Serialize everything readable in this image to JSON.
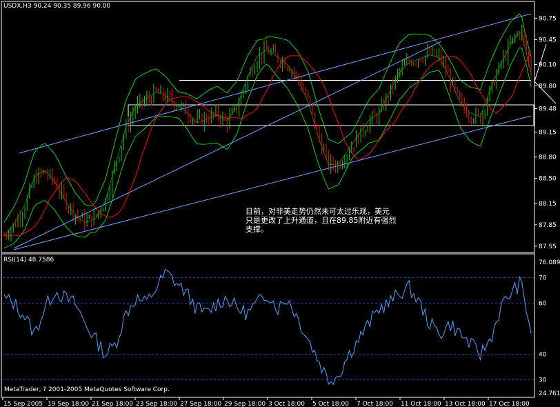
{
  "window": {
    "symbol_header": "USDX,H3  90.24 90.35 89.96 90.00",
    "copyright": "MetaTrader, ? 2001-2005 MetaQuotes Software Corp."
  },
  "annotation": {
    "line1": "目前，对非美走势仍然未可太过乐观，美元",
    "line2": "只是更改了上升通道，且在89.85附近有强烈",
    "line3": "支撑。"
  },
  "colors": {
    "background": "#000000",
    "frame": "#ffffff",
    "bull_candle": "#00cc00",
    "bear_candle": "#ff0000",
    "bollinger": "#00ff00",
    "moving_average": "#ff0000",
    "trendlines": "#6ea0ff",
    "rsi_line": "#4aa3ff",
    "rsi_levels": "#1f3fbf"
  },
  "chart_data": [
    {
      "type": "line",
      "title": "USDX,H3  90.24 90.35 89.96 90.00",
      "yticks": [
        "90.75",
        "90.45",
        "90.10",
        "89.80",
        "89.48",
        "89.15",
        "88.80",
        "88.50",
        "88.15",
        "87.85",
        "87.55"
      ],
      "ylim": [
        87.5,
        90.85
      ],
      "x_labels": [
        "15 Sep 2005",
        "19 Sep 18:00",
        "21 Sep 18:00",
        "23 Sep 18:00",
        "27 Sep 18:00",
        "29 Sep 18:00",
        "3 Oct 18:00",
        "5 Oct 18:00",
        "7 Oct 18:00",
        "11 Oct 18:00",
        "13 Oct 18:00",
        "17 Oct 18:00"
      ],
      "series": [
        {
          "values": [
            87.7,
            87.85,
            88.1,
            88.5,
            88.6,
            88.45,
            88.2,
            88.0,
            87.9,
            87.95,
            88.2,
            88.7,
            89.2,
            89.5,
            89.6,
            89.7,
            89.65,
            89.55,
            89.45,
            89.3,
            89.35,
            89.4,
            89.3,
            89.5,
            89.9,
            90.2,
            90.3,
            90.2,
            90.1,
            89.9,
            89.6,
            89.1,
            88.7,
            88.7,
            88.9,
            89.1,
            89.3,
            89.4,
            89.7,
            90.0,
            90.15,
            90.2,
            90.25,
            90.2,
            89.9,
            89.55,
            89.4,
            89.35,
            89.75,
            90.1,
            90.4,
            90.6,
            90.0
          ]
        }
      ]
    },
    {
      "type": "line",
      "title": "RSI(14) 48.7586",
      "yticks": [
        "76.0898",
        "70",
        "60",
        "40",
        "30",
        "24.7612"
      ],
      "ylim": [
        24.7612,
        76.0898
      ],
      "x_labels": [
        "15 Sep 2005",
        "19 Sep 18:00",
        "21 Sep 18:00",
        "23 Sep 18:00",
        "27 Sep 18:00",
        "29 Sep 18:00",
        "3 Oct 18:00",
        "5 Oct 18:00",
        "7 Oct 18:00",
        "11 Oct 18:00",
        "13 Oct 18:00",
        "17 Oct 18:00"
      ],
      "series": [
        {
          "values": [
            62,
            60,
            55,
            48,
            58,
            65,
            62,
            60,
            52,
            46,
            40,
            44,
            56,
            62,
            60,
            66,
            72,
            68,
            64,
            58,
            56,
            60,
            62,
            58,
            56,
            60,
            64,
            58,
            62,
            54,
            46,
            38,
            30,
            32,
            40,
            46,
            52,
            58,
            60,
            64,
            66,
            60,
            52,
            48,
            52,
            48,
            44,
            40,
            46,
            58,
            64,
            68,
            49
          ]
        }
      ]
    }
  ]
}
